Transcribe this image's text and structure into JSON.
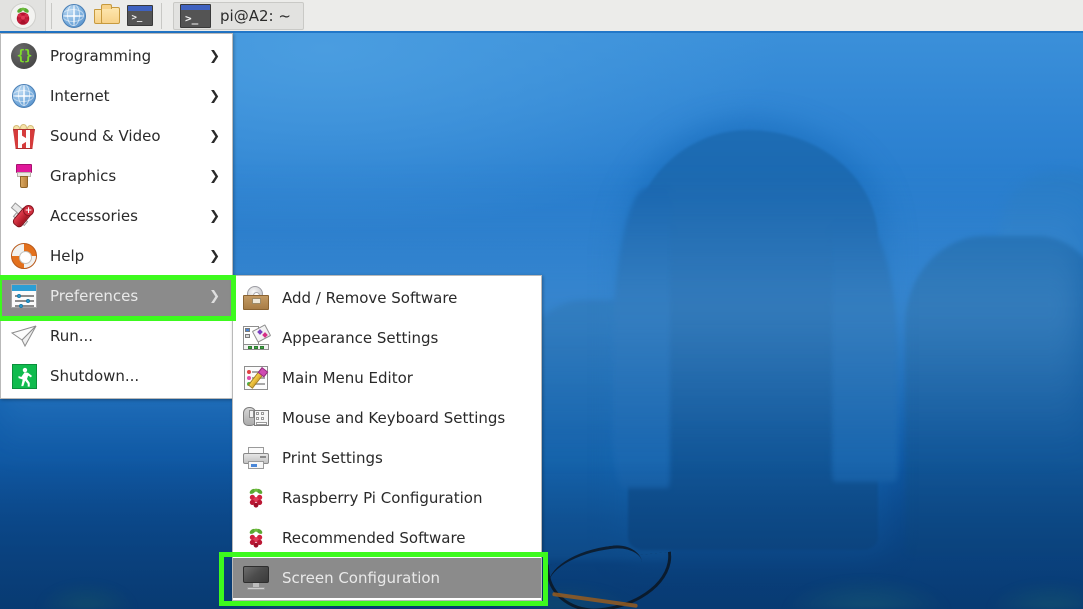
{
  "taskbar": {
    "menu_button_icon": "raspberry-pi-logo",
    "launchers": [
      {
        "icon": "web-browser-icon",
        "name": "web-browser"
      },
      {
        "icon": "file-manager-icon",
        "name": "file-manager"
      },
      {
        "icon": "terminal-icon",
        "name": "terminal"
      }
    ],
    "task_window": {
      "icon": "terminal-icon",
      "label": "pi@A2: ~"
    }
  },
  "main_menu": {
    "items": [
      {
        "label": "Programming",
        "icon": "code-braces-icon",
        "arrow": "❯",
        "has_submenu": true,
        "selected": false
      },
      {
        "label": "Internet",
        "icon": "globe-icon",
        "arrow": "❯",
        "has_submenu": true,
        "selected": false
      },
      {
        "label": "Sound & Video",
        "icon": "popcorn-media-icon",
        "arrow": "❯",
        "has_submenu": true,
        "selected": false
      },
      {
        "label": "Graphics",
        "icon": "paintbrush-icon",
        "arrow": "❯",
        "has_submenu": true,
        "selected": false
      },
      {
        "label": "Accessories",
        "icon": "pocket-knife-icon",
        "arrow": "❯",
        "has_submenu": true,
        "selected": false
      },
      {
        "label": "Help",
        "icon": "life-ring-icon",
        "arrow": "❯",
        "has_submenu": true,
        "selected": false
      },
      {
        "label": "Preferences",
        "icon": "settings-sliders-icon",
        "arrow": "❯",
        "has_submenu": true,
        "selected": true
      },
      {
        "label": "Run...",
        "icon": "paper-plane-icon",
        "arrow": "",
        "has_submenu": false,
        "selected": false
      },
      {
        "label": "Shutdown...",
        "icon": "exit-runner-icon",
        "arrow": "",
        "has_submenu": false,
        "selected": false
      }
    ]
  },
  "sub_menu": {
    "parent": "Preferences",
    "items": [
      {
        "label": "Add / Remove Software",
        "icon": "software-briefcase-icon",
        "selected": false
      },
      {
        "label": "Appearance Settings",
        "icon": "color-palette-icon",
        "selected": false
      },
      {
        "label": "Main Menu Editor",
        "icon": "menu-pencil-icon",
        "selected": false
      },
      {
        "label": "Mouse and Keyboard Settings",
        "icon": "mouse-keyboard-icon",
        "selected": false
      },
      {
        "label": "Print Settings",
        "icon": "printer-icon",
        "selected": false
      },
      {
        "label": "Raspberry Pi Configuration",
        "icon": "raspberry-pi-icon",
        "selected": false
      },
      {
        "label": "Recommended Software",
        "icon": "raspberry-pi-icon",
        "selected": false
      },
      {
        "label": "Screen Configuration",
        "icon": "monitor-icon",
        "selected": true
      }
    ]
  },
  "annotations": [
    {
      "name": "preferences-highlight",
      "target": "Preferences",
      "color": "#3dfa1e"
    },
    {
      "name": "screen-config-highlight",
      "target": "Screen Configuration",
      "color": "#3dfa1e"
    }
  ],
  "desktop": {
    "wallpaper_description": "blue karst mountain landscape with boat",
    "accent_color": "#2277c8",
    "taskbar_color": "#ececea",
    "selection_color": "#8b8b8b"
  }
}
